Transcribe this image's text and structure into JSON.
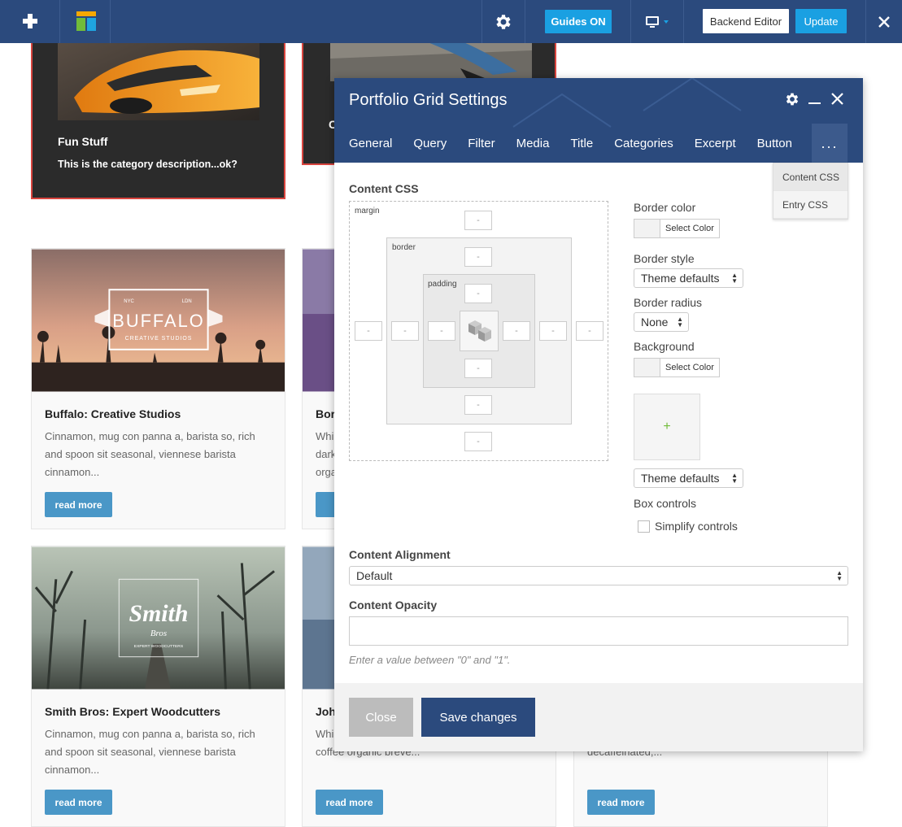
{
  "toolbar": {
    "guides_label": "Guides ON",
    "backend_label": "Backend Editor",
    "update_label": "Update"
  },
  "page": {
    "top_cards": [
      {
        "title": "Fun Stuff",
        "desc": "This is the category description...ok?"
      },
      {
        "title": "C"
      }
    ],
    "cards": [
      {
        "title": "Buffalo: Creative Studios",
        "text": "Cinnamon, mug con panna a, barista so, rich and spoon sit seasonal, viennese barista cinnamon...",
        "button": "read more",
        "image_text": "BUFFALO",
        "image_sub": "CREATIVE STUDIOS",
        "image_top": "NYC",
        "image_top2": "LDN"
      },
      {
        "title": "Bor",
        "text": "Whi dark orga",
        "button": "re"
      },
      {
        "title": "Smith Bros: Expert Woodcutters",
        "text": "Cinnamon, mug con panna a, barista so, rich and spoon sit seasonal, viennese barista cinnamon...",
        "button": "read more",
        "image_text": "Smith",
        "image_sub": "Bros",
        "image_sub2": "EXPERT WOODCUTTERS"
      },
      {
        "title": "John",
        "text": "Whi dark macchiato mug cafe au lait cup coffee organic breve...",
        "button": "read more"
      },
      {
        "title": "",
        "text": "cu milk, doppio, lungo iced cafe au lait decaffeinated,...",
        "button": "read more"
      }
    ]
  },
  "dialog": {
    "title": "Portfolio Grid Settings",
    "tabs": [
      "General",
      "Query",
      "Filter",
      "Media",
      "Title",
      "Categories",
      "Excerpt",
      "Button"
    ],
    "more_label": "...",
    "dropdown": [
      "Content CSS",
      "Entry CSS"
    ],
    "content_css_label": "Content CSS",
    "box": {
      "margin_label": "margin",
      "border_label": "border",
      "padding_label": "padding",
      "placeholder": "-"
    },
    "border_color_label": "Border color",
    "select_color": "Select Color",
    "border_style_label": "Border style",
    "border_style_value": "Theme defaults",
    "border_radius_label": "Border radius",
    "border_radius_value": "None",
    "background_label": "Background",
    "upload_plus": "+",
    "bg_style_value": "Theme defaults",
    "box_controls_label": "Box controls",
    "simplify_label": "Simplify controls",
    "alignment_label": "Content Alignment",
    "alignment_value": "Default",
    "opacity_label": "Content Opacity",
    "opacity_hint": "Enter a value between \"0\" and \"1\".",
    "close_label": "Close",
    "save_label": "Save changes"
  }
}
